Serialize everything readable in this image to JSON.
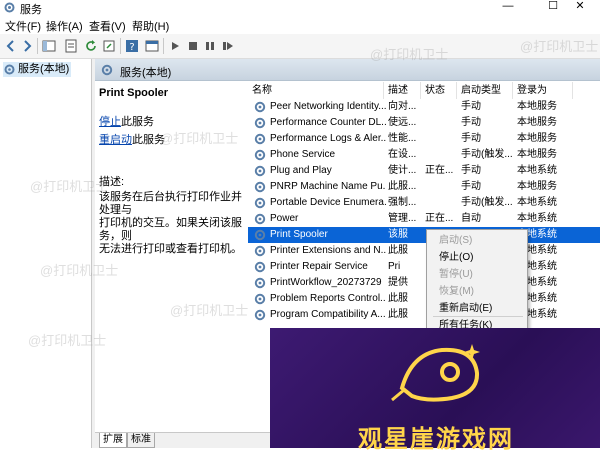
{
  "window": {
    "title": "服务"
  },
  "menu": [
    "文件(F)",
    "操作(A)",
    "查看(V)",
    "帮助(H)"
  ],
  "tree": {
    "root": "服务(本地)"
  },
  "pane": {
    "header": "服务(本地)"
  },
  "description": {
    "service_name": "Print Spooler",
    "stop_link": "停止",
    "stop_suffix": "此服务",
    "restart_link": "重启动",
    "restart_suffix": "此服务",
    "label": "描述:",
    "lines": [
      "该服务在后台执行打印作业并处理与",
      "打印机的交互。如果关闭该服务，则",
      "无法进行打印或查看打印机。"
    ]
  },
  "columns": [
    "名称",
    "描述",
    "状态",
    "启动类型",
    "登录为"
  ],
  "rows": [
    {
      "name": "Peer Networking Identity...",
      "desc": "向对...",
      "status": "",
      "startup": "手动",
      "logon": "本地服务"
    },
    {
      "name": "Performance Counter DL...",
      "desc": "使远...",
      "status": "",
      "startup": "手动",
      "logon": "本地服务"
    },
    {
      "name": "Performance Logs & Aler...",
      "desc": "性能...",
      "status": "",
      "startup": "手动",
      "logon": "本地服务"
    },
    {
      "name": "Phone Service",
      "desc": "在设...",
      "status": "",
      "startup": "手动(触发...",
      "logon": "本地服务"
    },
    {
      "name": "Plug and Play",
      "desc": "使计...",
      "status": "正在...",
      "startup": "手动",
      "logon": "本地系统"
    },
    {
      "name": "PNRP Machine Name Pu...",
      "desc": "此服...",
      "status": "",
      "startup": "手动",
      "logon": "本地服务"
    },
    {
      "name": "Portable Device Enumera...",
      "desc": "强制...",
      "status": "",
      "startup": "手动(触发...",
      "logon": "本地系统"
    },
    {
      "name": "Power",
      "desc": "管理...",
      "status": "正在...",
      "startup": "自动",
      "logon": "本地系统"
    },
    {
      "name": "Print Spooler",
      "desc": "该服",
      "status": "",
      "startup": "",
      "logon": "本地系统"
    },
    {
      "name": "Printer Extensions and N...",
      "desc": "此服",
      "status": "",
      "startup": "",
      "logon": "本地系统"
    },
    {
      "name": "Printer Repair Service",
      "desc": "Pri",
      "status": "",
      "startup": "",
      "logon": "本地系统"
    },
    {
      "name": "PrintWorkflow_20273729",
      "desc": "提供",
      "status": "",
      "startup": "",
      "logon": "本地系统"
    },
    {
      "name": "Problem Reports Control...",
      "desc": "此服",
      "status": "",
      "startup": "",
      "logon": "本地系统"
    },
    {
      "name": "Program Compatibility A...",
      "desc": "此服",
      "status": "",
      "startup": "",
      "logon": "本地系统"
    }
  ],
  "context_menu": [
    {
      "label": "启动(S)",
      "disabled": true
    },
    {
      "label": "停止(O)",
      "disabled": false
    },
    {
      "label": "暂停(U)",
      "disabled": true
    },
    {
      "label": "恢复(M)",
      "disabled": true
    },
    {
      "label": "重新启动(E)",
      "disabled": false
    },
    {
      "label": "所有任务(K)",
      "disabled": false
    }
  ],
  "tabs": [
    "扩展",
    "标准"
  ],
  "watermark": "@打印机卫士",
  "ad": {
    "text": "观星崖游戏网"
  },
  "colors": {
    "selection": "#0a64d6",
    "link": "#0645ad"
  }
}
